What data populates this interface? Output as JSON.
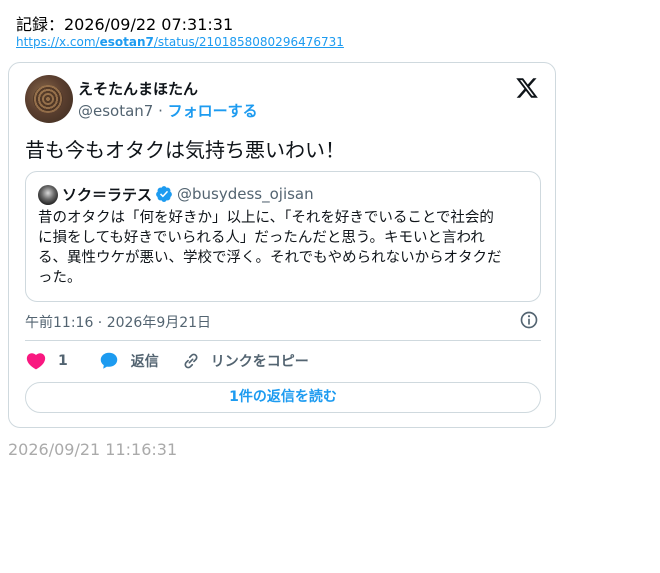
{
  "record": {
    "label": "記録：2026/09/22 07:31:31"
  },
  "source_url": {
    "prefix": "https://x.com/",
    "user": "esotan7",
    "suffix": "/status/2101858080296476731"
  },
  "tweet": {
    "display_name": "えそたんまほたん",
    "handle": "@esotan7",
    "separator": " · ",
    "follow_label": "フォローする",
    "text": "昔も今もオタクは気持ち悪いわい！",
    "timestamp": "午前11:16 · 2026年9月21日",
    "like_count": "1",
    "reply_label": "返信",
    "copy_link_label": "リンクをコピー",
    "read_replies_label": "1件の返信を読む"
  },
  "quote": {
    "display_name": "ソク＝ラテス",
    "handle": "@busydess_ojisan",
    "lines": [
      "昔のオタクは「何を好きか」以上に、「それを好きでいることで社会的",
      "に損をしても好きでいられる人」だったんだと思う。キモいと言われ",
      "る、異性ウケが悪い、学校で浮く。それでもやめられないからオタクだ",
      "った。"
    ]
  },
  "footer": {
    "captured_time": "2026/09/21 11:16:31"
  },
  "colors": {
    "accent": "#1d9bf0",
    "like": "#f91880",
    "muted": "#536471",
    "border": "#cfd9de"
  },
  "icons": {
    "brand": "x-logo-icon",
    "verified": "verified-badge-icon",
    "info": "info-icon",
    "like": "heart-icon",
    "reply": "speech-bubble-icon",
    "copy": "link-icon"
  }
}
